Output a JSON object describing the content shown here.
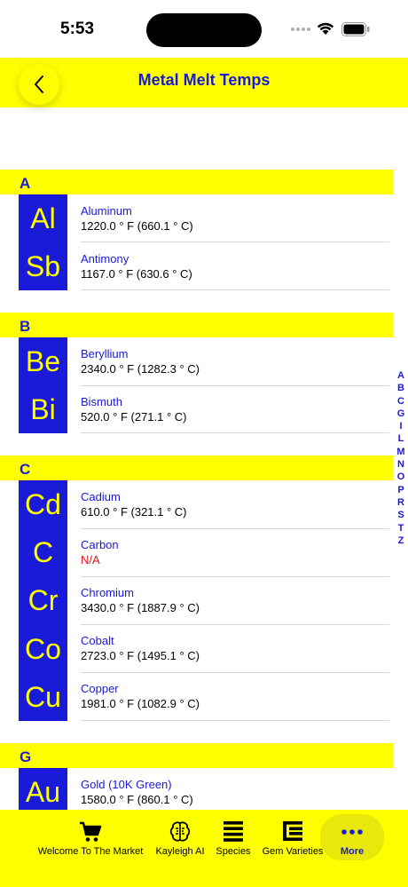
{
  "status": {
    "time": "5:53"
  },
  "nav": {
    "title": "Metal Melt Temps"
  },
  "sections": [
    {
      "letter": "A",
      "items": [
        {
          "symbol": "Al",
          "name": "Aluminum",
          "temp": "1220.0 ° F (660.1 ° C)"
        },
        {
          "symbol": "Sb",
          "name": "Antimony",
          "temp": "1167.0 ° F (630.6 ° C)"
        }
      ]
    },
    {
      "letter": "B",
      "items": [
        {
          "symbol": "Be",
          "name": "Beryllium",
          "temp": "2340.0 ° F (1282.3 ° C)"
        },
        {
          "symbol": "Bi",
          "name": "Bismuth",
          "temp": "520.0 ° F (271.1 ° C)"
        }
      ]
    },
    {
      "letter": "C",
      "items": [
        {
          "symbol": "Cd",
          "name": "Cadium",
          "temp": "610.0 ° F (321.1 ° C)"
        },
        {
          "symbol": "C",
          "name": "Carbon",
          "temp": "N/A"
        },
        {
          "symbol": "Cr",
          "name": "Chromium",
          "temp": "3430.0 ° F (1887.9 ° C)"
        },
        {
          "symbol": "Co",
          "name": "Cobalt",
          "temp": "2723.0 ° F (1495.1 ° C)"
        },
        {
          "symbol": "Cu",
          "name": "Copper",
          "temp": "1981.0 ° F (1082.9 ° C)"
        }
      ]
    },
    {
      "letter": "G",
      "items": [
        {
          "symbol": "Au",
          "name": "Gold (10K Green)",
          "temp": "1580.0 ° F (860.1 ° C)"
        }
      ]
    }
  ],
  "index": [
    "A",
    "B",
    "C",
    "G",
    "I",
    "L",
    "M",
    "N",
    "O",
    "P",
    "R",
    "S",
    "T",
    "Z"
  ],
  "tabs": [
    {
      "label": "Welcome To The Market",
      "icon": "cart-icon"
    },
    {
      "label": "Kayleigh AI",
      "icon": "brain-icon"
    },
    {
      "label": "Species",
      "icon": "list-icon"
    },
    {
      "label": "Gem Varieties",
      "icon": "varieties-icon"
    },
    {
      "label": "More",
      "icon": "more-icon",
      "active": true
    }
  ],
  "colors": {
    "accent": "#ffff00",
    "primary": "#1a1ad9",
    "na": "#e01010"
  }
}
